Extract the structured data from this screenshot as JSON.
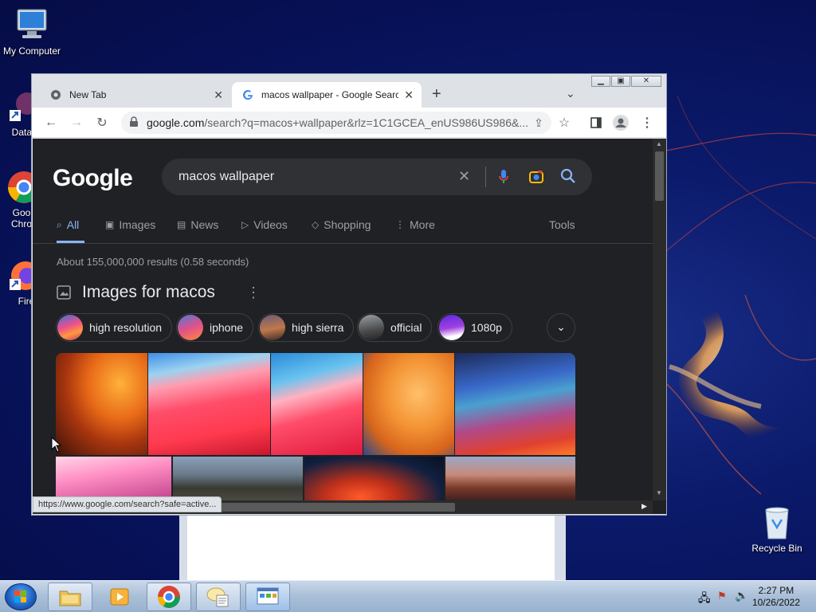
{
  "desktop": {
    "icons": [
      {
        "label": "My Computer"
      },
      {
        "label": "DataW"
      },
      {
        "label": "Goo Chro"
      },
      {
        "label": "Fire"
      },
      {
        "label": "Recycle Bin"
      }
    ]
  },
  "browser": {
    "tabs": [
      {
        "title": "New Tab"
      },
      {
        "title": "macos wallpaper - Google Searc"
      }
    ],
    "new_tab_symbol": "+",
    "url_domain": "google.com",
    "url_path": "/search?q=macos+wallpaper&rlz=1C1GCEA_enUS986US986&...",
    "status_url": "https://www.google.com/search?safe=active..."
  },
  "google": {
    "logo": "Google",
    "query": "macos wallpaper",
    "nav": [
      {
        "label": "All",
        "icon": "search-icon"
      },
      {
        "label": "Images",
        "icon": "image-icon"
      },
      {
        "label": "News",
        "icon": "news-icon"
      },
      {
        "label": "Videos",
        "icon": "play-icon"
      },
      {
        "label": "Shopping",
        "icon": "tag-icon"
      },
      {
        "label": "More",
        "icon": "dots-vertical-icon"
      }
    ],
    "tools_label": "Tools",
    "stats": "About 155,000,000 results (0.58 seconds)",
    "images_section_title": "Images for macos",
    "chips": [
      {
        "label": "high resolution"
      },
      {
        "label": "iphone"
      },
      {
        "label": "high sierra"
      },
      {
        "label": "official"
      },
      {
        "label": "1080p"
      }
    ],
    "accent_color": "#8ab4f8"
  },
  "taskbar": {
    "time": "2:27 PM",
    "date": "10/26/2022"
  }
}
